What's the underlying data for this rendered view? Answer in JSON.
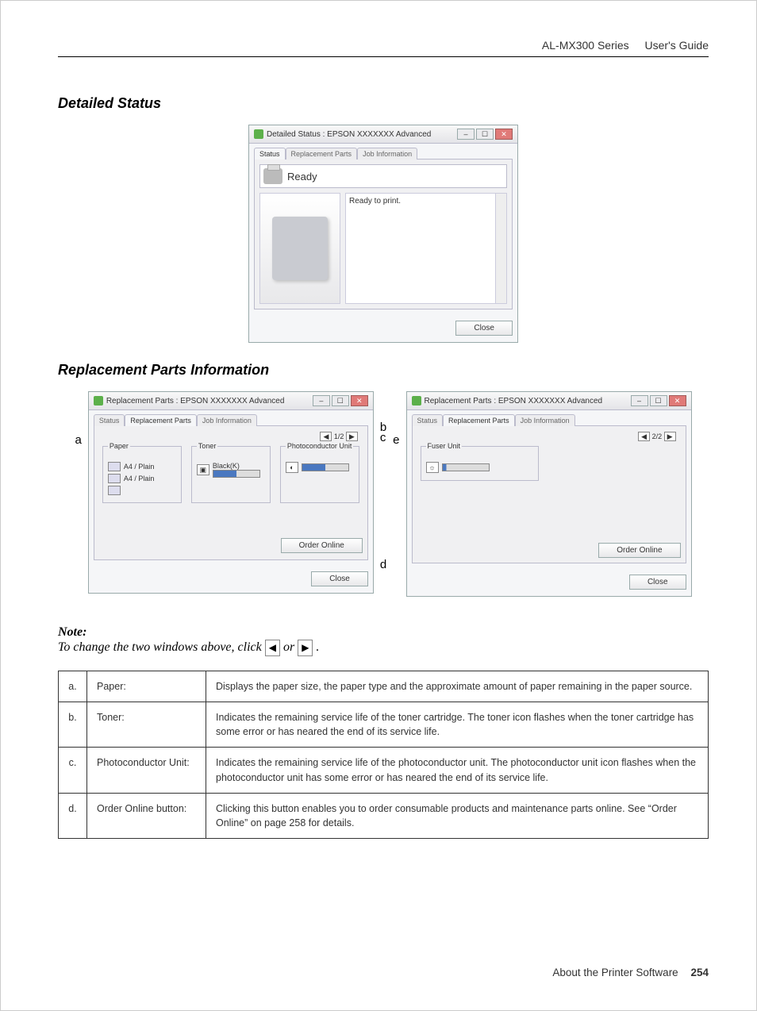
{
  "header": {
    "product": "AL-MX300 Series",
    "guide": "User's Guide"
  },
  "section1": {
    "title": "Detailed Status"
  },
  "ds": {
    "title": "Detailed Status : EPSON XXXXXXX Advanced",
    "tabs": {
      "status": "Status",
      "replacement": "Replacement Parts",
      "job": "Job Information"
    },
    "ready": "Ready",
    "message": "Ready to print.",
    "close": "Close"
  },
  "section2": {
    "title": "Replacement Parts Information"
  },
  "rp": {
    "title": "Replacement Parts : EPSON XXXXXXX Advanced",
    "tabs": {
      "status": "Status",
      "replacement": "Replacement Parts",
      "job": "Job Information"
    },
    "page1": "1/2",
    "page2": "2/2",
    "group_paper": "Paper",
    "group_toner": "Toner",
    "group_photo": "Photoconductor Unit",
    "group_fuser": "Fuser Unit",
    "tray_label": "A4 / Plain",
    "toner_black": "Black(K)",
    "order": "Order Online",
    "close": "Close"
  },
  "callouts": {
    "a": "a",
    "b": "b",
    "c": "c",
    "d": "d",
    "e": "e"
  },
  "note": {
    "label": "Note:",
    "body_before": "To change the two windows above, click ",
    "or": " or ",
    "body_after": "."
  },
  "defs": {
    "rows": [
      {
        "k": "a.",
        "n": "Paper:",
        "d": "Displays the paper size, the paper type and the approximate amount of paper remaining in the paper source."
      },
      {
        "k": "b.",
        "n": "Toner:",
        "d": "Indicates the remaining service life of the toner cartridge. The toner icon flashes when the toner cartridge has some error or has neared the end of its service life."
      },
      {
        "k": "c.",
        "n": "Photoconductor Unit:",
        "d": "Indicates the remaining service life of the photoconductor unit. The photoconductor unit icon flashes when the photoconductor unit has some error or has neared the end of its service life."
      },
      {
        "k": "d.",
        "n": "Order Online button:",
        "d": "Clicking this button enables you to order consumable products and maintenance parts online. See “Order Online” on page 258 for details."
      }
    ]
  },
  "footer": {
    "chapter": "About the Printer Software",
    "page": "254"
  }
}
